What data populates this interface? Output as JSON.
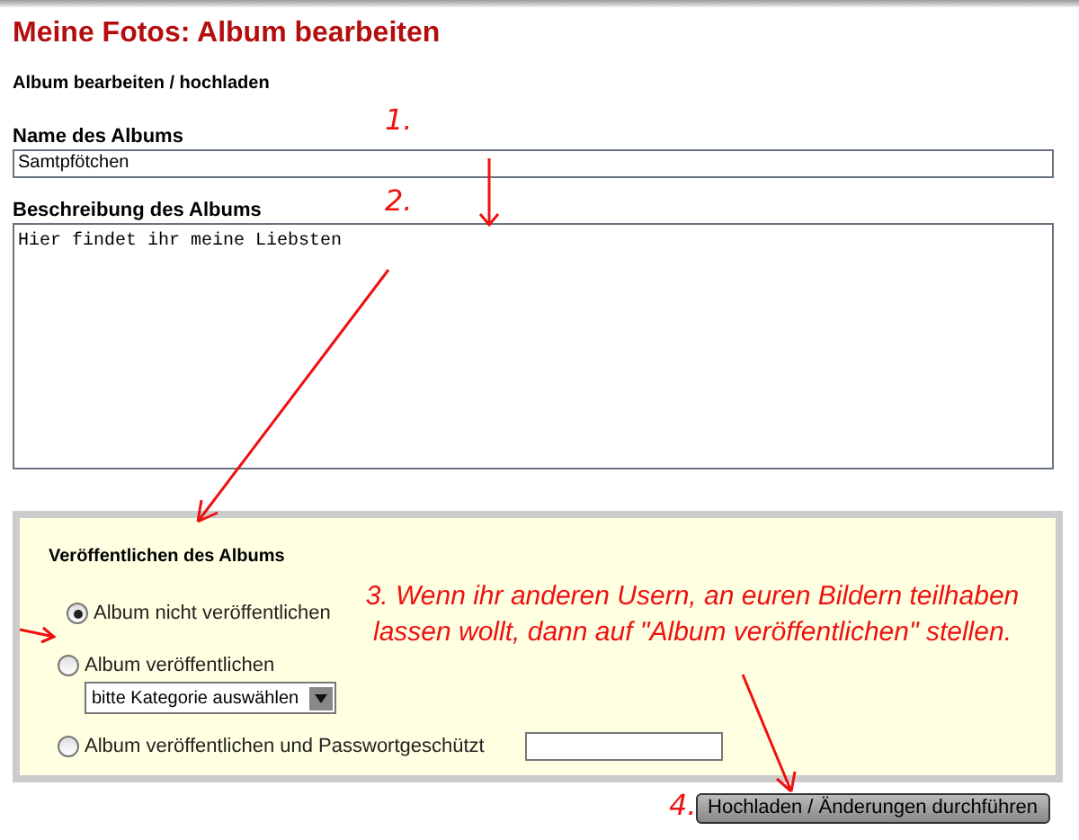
{
  "page": {
    "title": "Meine Fotos: Album bearbeiten",
    "subtitle": "Album bearbeiten / hochladen"
  },
  "fields": [
    {
      "kind": "input",
      "label": "Name des Albums",
      "value": "Samtpfötchen"
    },
    {
      "kind": "textarea",
      "label": "Beschreibung des Albums",
      "value": "Hier findet ihr meine Liebsten"
    }
  ],
  "publish": {
    "heading": "Veröffentlichen des Albums",
    "options": [
      {
        "label": "Album nicht veröffentlichen",
        "selected": true,
        "kind": "plain"
      },
      {
        "label": "Album veröffentlichen",
        "selected": false,
        "kind": "category",
        "select_value": "bitte Kategorie auswählen"
      },
      {
        "label": "Album veröffentlichen und Passwortgeschützt",
        "selected": false,
        "kind": "password"
      }
    ]
  },
  "submit_button": "Hochladen / Änderungen durchführen",
  "annotations": [
    {
      "kind": "step",
      "text": "1."
    },
    {
      "kind": "step",
      "text": "2."
    },
    {
      "kind": "note",
      "text": "3. Wenn ihr anderen Usern, an euren Bildern teilhaben lassen wollt, dann auf \"Album veröffentlichen\" stellen."
    },
    {
      "kind": "step",
      "text": "4."
    }
  ]
}
